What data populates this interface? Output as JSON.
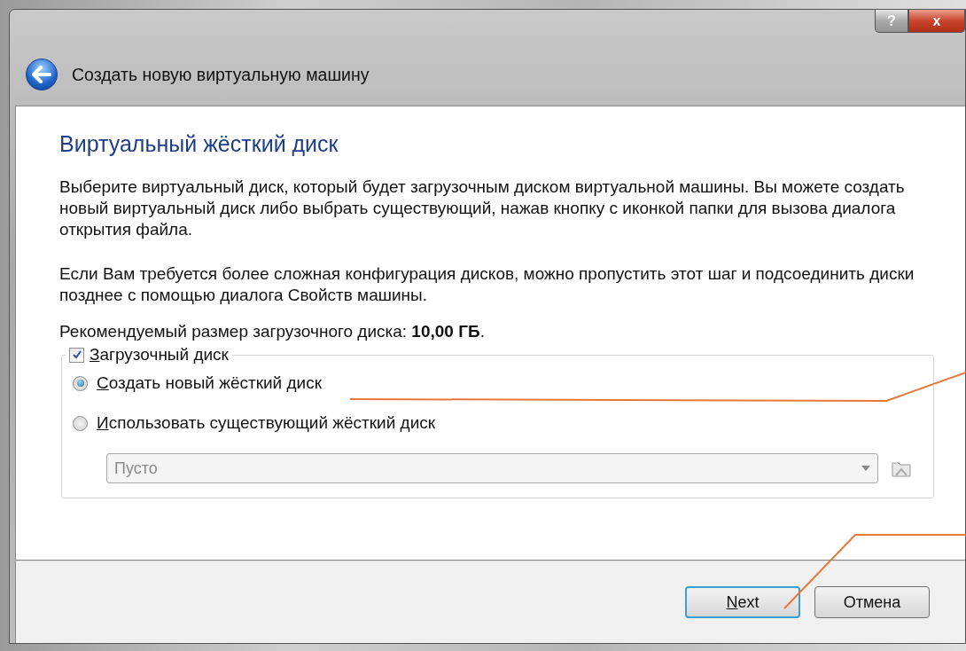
{
  "window": {
    "title": "Создать новую виртуальную машину",
    "help_button": "?",
    "close_button": "x",
    "back_button": {
      "disabled": false
    }
  },
  "page": {
    "heading": "Виртуальный жёсткий диск",
    "paragraphs": [
      "Выберите виртуальный диск, который будет загрузочным диском виртуальной машины. Вы можете создать новый виртуальный диск либо выбрать существующий, нажав кнопку с иконкой папки для вызова диалога открытия файла.",
      "Если Вам требуется более сложная конфигурация дисков, можно пропустить этот шаг и подсоединить диски позднее с помощью диалога Свойств машины."
    ],
    "recommended": "Рекомендуемый размер загрузочного диска: **10,00 ГБ**.",
    "boot_disk": {
      "label": "Загрузочный диск",
      "checked": true,
      "options": [
        {
          "label": "Создать новый жёсткий диск",
          "selected": true
        },
        {
          "label": "Использовать существующий жёсткий диск",
          "selected": false
        }
      ],
      "disk_select": {
        "value": "Пусто",
        "disabled": true
      }
    }
  },
  "buttons": [
    {
      "label": "Next",
      "default": true
    },
    {
      "label": "Отмена",
      "default": false
    }
  ]
}
